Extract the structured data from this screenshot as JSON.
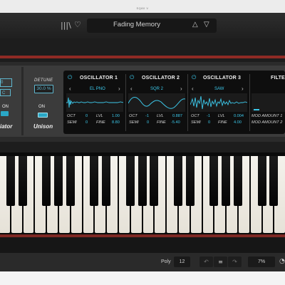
{
  "window": {
    "title": "SQ80 V"
  },
  "toolbar": {
    "library_icon": "|||\\",
    "favorite_icon": "♡",
    "preset_name": "Fading Memory",
    "prev_icon": "△",
    "next_icon": "▽"
  },
  "left_panel": {
    "value1": "0",
    "value2": "C",
    "on_label": "ON",
    "section_label": "iator"
  },
  "unison": {
    "detune_label": "DETUNE",
    "detune_value": "30.0 %",
    "on_label": "ON",
    "section_label": "Unison"
  },
  "oscillators": [
    {
      "name": "OSCILLATOR 1",
      "waveform": "EL PNO",
      "oct": "0",
      "semi": "0",
      "lvl": "1.00",
      "fine": "8.80"
    },
    {
      "name": "OSCILLATOR 2",
      "waveform": "SQR 2",
      "oct": "-1",
      "semi": "0",
      "lvl": "0.887",
      "fine": "-5.40"
    },
    {
      "name": "OSCILLATOR 3",
      "waveform": "SAW",
      "oct": "-1",
      "semi": "0",
      "lvl": "0.004",
      "fine": "4.00"
    }
  ],
  "osc_labels": {
    "oct": "OCT",
    "semi": "SEMI",
    "lvl": "LVL",
    "fine": "FINE",
    "power_icon": "⏻",
    "left_chev": "‹",
    "right_chev": "›"
  },
  "filter": {
    "name": "FILTE",
    "mod1": "MOD AMOUNT 1",
    "mod2": "MOD AMOUNT 2"
  },
  "footer": {
    "poly_label": "Poly",
    "poly_value": "12",
    "undo_icon": "↶",
    "history_icon": "≡",
    "redo_icon": "↷",
    "cpu_value": "7%",
    "corner_icon": "◔"
  },
  "colors": {
    "accent": "#3cc8ea",
    "brand_red": "#8f2a25",
    "panel": "#3b3b3b"
  }
}
